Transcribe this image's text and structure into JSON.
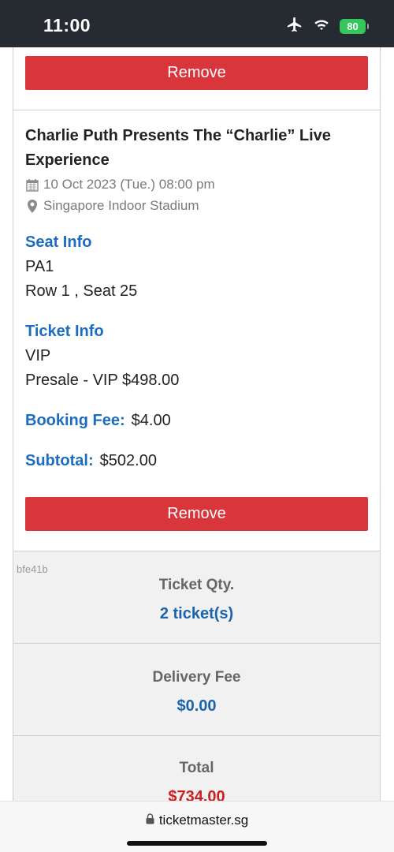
{
  "status_bar": {
    "time": "11:00",
    "battery": "80",
    "icons": [
      "airplane-icon",
      "wifi-icon",
      "battery-charging-icon"
    ]
  },
  "previous_item": {
    "remove_label": "Remove"
  },
  "event": {
    "title": "Charlie Puth Presents The “Charlie” Live Experience",
    "datetime": "10 Oct 2023 (Tue.) 08:00 pm",
    "venue": "Singapore Indoor Stadium",
    "seat_info_label": "Seat Info",
    "seat_section": "PA1",
    "seat_row_seat": "Row 1 , Seat 25",
    "ticket_info_label": "Ticket Info",
    "ticket_type": "VIP",
    "ticket_price_line": "Presale - VIP $498.00",
    "booking_fee_label": "Booking Fee:",
    "booking_fee_value": "$4.00",
    "subtotal_label": "Subtotal:",
    "subtotal_value": "$502.00",
    "remove_label": "Remove"
  },
  "summary": {
    "code": "bfe41b",
    "ticket_qty_label": "Ticket Qty.",
    "ticket_qty_value": "2 ticket(s)",
    "delivery_fee_label": "Delivery Fee",
    "delivery_fee_value": "$0.00",
    "total_label": "Total",
    "total_value": "$734.00"
  },
  "browser": {
    "url": "ticketmaster.sg"
  },
  "colors": {
    "remove_button": "#d9363b",
    "link_blue": "#1c6dc1",
    "total_red": "#cc1f1f",
    "status_bar_bg": "#262b31"
  }
}
